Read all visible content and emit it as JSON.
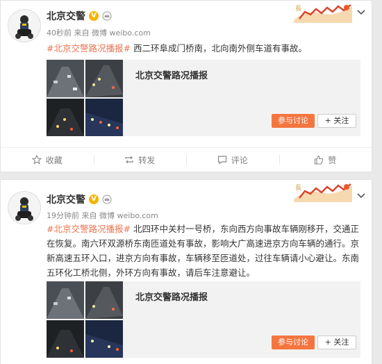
{
  "posts": [
    {
      "author": "北京交警",
      "verified_icon": "verified-badge-icon",
      "crown_icon": "crown-icon",
      "time": "40秒前",
      "source_prefix": "来自",
      "source": "微博 weibo.com",
      "topic": "#北京交警路况播报#",
      "body": "西二环阜成门桥南，北向南外侧车道有事故。",
      "card_title": "北京交警路况播报",
      "join_label": "参与讨论",
      "follow_label": "关注",
      "actions": {
        "collect": "收藏",
        "repost": "转发",
        "comment": "评论",
        "like": "赞"
      }
    },
    {
      "author": "北京交警",
      "verified_icon": "verified-badge-icon",
      "crown_icon": "crown-icon",
      "time": "19分钟前",
      "source_prefix": "来自",
      "source": "微博 weibo.com",
      "topic": "#北京交警路况播报#",
      "body": "北四环中关村一号桥，东向西方向事故车辆刚移开，交通正在恢复。南六环双源桥东南匝道处有事故，影响大广高速进京方向车辆的通行。京新高速五环入口，进京方向有事故，车辆移至匝道处，过往车辆请小心避让。东南五环化工桥北侧，外环方向有事故，请后车注意避让。",
      "card_title": "北京交警路况播报",
      "join_label": "参与讨论",
      "follow_label": "关注"
    }
  ],
  "colors": {
    "topic": "#eb7350",
    "join_button": "#f5753f",
    "verified": "#f6b400"
  }
}
